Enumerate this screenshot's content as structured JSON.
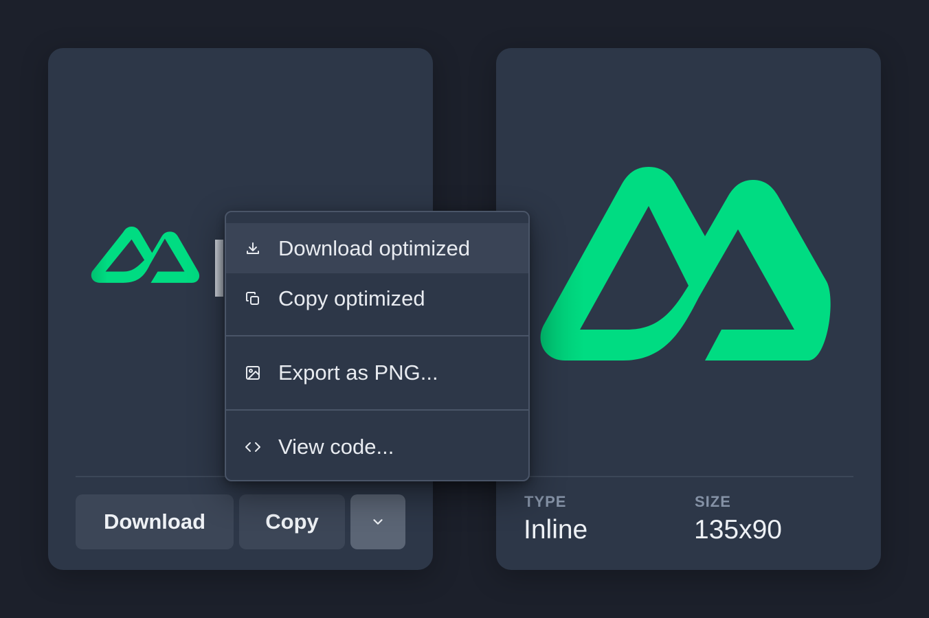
{
  "left_card": {
    "buttons": {
      "download": "Download",
      "copy": "Copy",
      "more_icon": "chevron-down-icon"
    }
  },
  "menu": {
    "items": [
      {
        "label": "Download optimized",
        "icon": "download-icon",
        "active": true
      },
      {
        "label": "Copy optimized",
        "icon": "copy-icon",
        "active": false
      },
      {
        "label": "Export as PNG...",
        "icon": "image-icon",
        "active": false
      },
      {
        "label": "View code...",
        "icon": "code-icon",
        "active": false
      }
    ]
  },
  "right_card": {
    "type_label": "TYPE",
    "type_value": "Inline",
    "size_label": "SIZE",
    "size_value": "135x90"
  },
  "colors": {
    "background": "#1c202b",
    "card": "#2d3748",
    "accent_green": "#00dc82",
    "text": "#eef1f5",
    "muted": "#8592a6"
  }
}
